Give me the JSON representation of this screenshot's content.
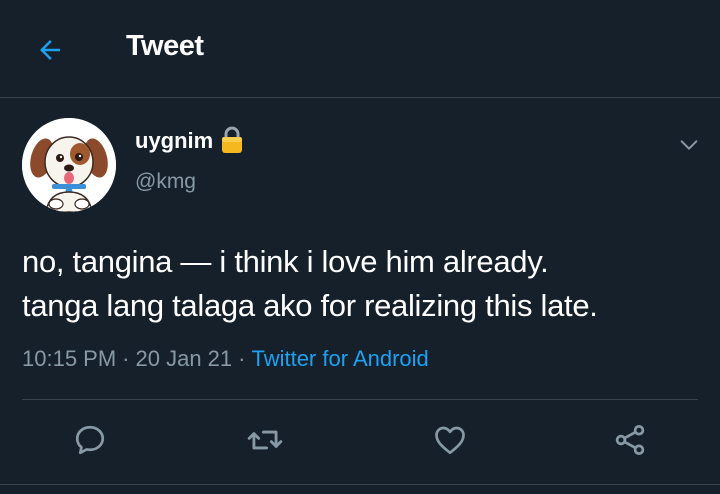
{
  "header": {
    "title": "Tweet",
    "back_icon": "arrow-left-icon",
    "accent": "#1da1f2"
  },
  "tweet": {
    "display_name": "uygnim",
    "username": "@kmg",
    "protected_icon": "lock-icon",
    "avatar_icon": "dog-avatar",
    "menu_icon": "chevron-down-icon",
    "text_line1": "no, tangina — i think i love him already.",
    "text_line2": "tanga lang talaga ako for realizing this late.",
    "time": "10:15 PM",
    "date": "20 Jan 21",
    "separator": "·",
    "source": "Twitter for Android"
  },
  "actions": [
    {
      "name": "reply",
      "icon": "reply-icon"
    },
    {
      "name": "retweet",
      "icon": "retweet-icon"
    },
    {
      "name": "like",
      "icon": "heart-icon"
    },
    {
      "name": "share",
      "icon": "share-icon"
    }
  ],
  "colors": {
    "background": "#15202b",
    "border": "#38444d",
    "secondary_text": "#8899a6",
    "link": "#1da1f2"
  }
}
